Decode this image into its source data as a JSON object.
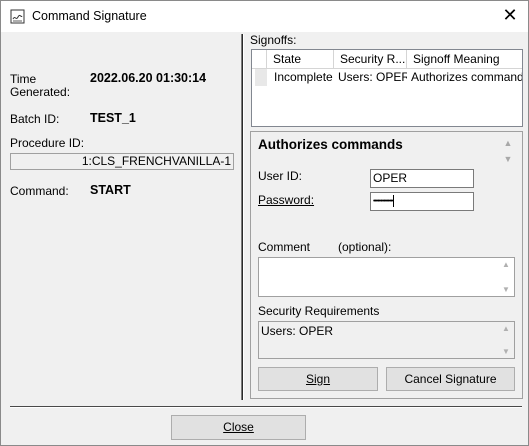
{
  "window": {
    "title": "Command Signature",
    "close_glyph": "✕"
  },
  "info": {
    "time_label_line1": "Time",
    "time_label_line2": "Generated:",
    "time_value": "2022.06.20 01:30:14",
    "batch_label": "Batch ID:",
    "batch_value": "TEST_1",
    "procedure_label": "Procedure ID:",
    "procedure_value": "1:CLS_FRENCHVANILLA-1",
    "command_label": "Command:",
    "command_value": "START"
  },
  "signoffs": {
    "label": "Signoffs:",
    "columns": [
      "State",
      "Security R...",
      "Signoff Meaning"
    ],
    "rows": [
      {
        "state": "Incomplete",
        "security": "Users: OPER",
        "meaning": "Authorizes commands"
      }
    ]
  },
  "auth": {
    "title": "Authorizes commands",
    "user_label": "User ID:",
    "user_value": "OPER",
    "password_label": "Password:",
    "password_value": "••••••••••••••",
    "comment_label": "Comment",
    "comment_optional": "(optional):",
    "comment_value": "",
    "security_label": "Security Requirements",
    "security_value": "Users: OPER",
    "sign_button": "Sign",
    "cancel_button": "Cancel Signature"
  },
  "footer": {
    "close_button": "Close"
  },
  "icons": {
    "app_icon": "signature-document-icon",
    "close_icon": "close-icon"
  }
}
